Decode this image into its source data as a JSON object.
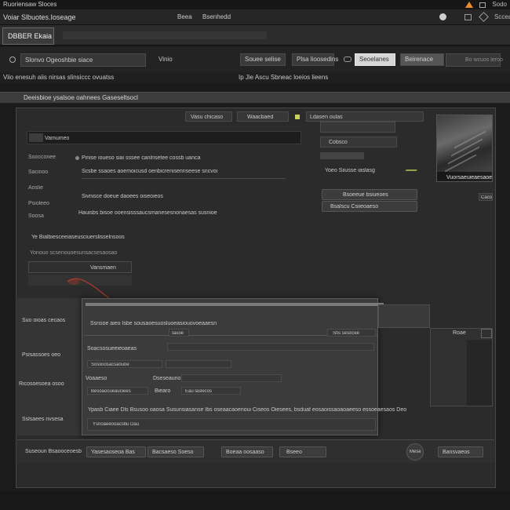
{
  "titlebar": {
    "title": "Ruoriensaw Sloces",
    "right_label": "Sodo"
  },
  "menubar": {
    "title": "Voiar Slbuotes.Ioseage",
    "items": [
      "Beea",
      "Bsenhedd",
      "Scceahs"
    ]
  },
  "tabs": {
    "active": "DBBER Ekaia"
  },
  "toolbar": {
    "location": "Slonvo Ogeoshbie siace",
    "view": "Vinio",
    "sort": "Souee selise",
    "filter": "Plsa lioosedins",
    "btn_light": "Seoelanes",
    "btn_dark": "Beirenace",
    "search_placeholder": "Bo wcuos leroo"
  },
  "address": {
    "path": "Viio enesuh aiis nirsas slinsiccc ovuatss",
    "right": "Ip Jie Ascu Sbneac loeios lieens"
  },
  "section": {
    "title": "Deeisbioe ysalsoe oahnees Gaseseltsocl"
  },
  "filterrow": {
    "a": "Vasu chicaso",
    "b": "Waacbaed",
    "c": "Ldasen oulas"
  },
  "main": {
    "field_label": "Vamumeo",
    "right_field": "Cobsco",
    "rows_left": [
      "Soocconee",
      "Sacinoo",
      "Aoslie",
      "Psioleeo",
      "Soosa"
    ],
    "row1": "Pinise ioueso siai sssee canlrisetee cossb uanca",
    "row2": "Scsbe ssaoes aoemoicusd oenbicrenisenriseese sncvoi",
    "row3": "Sivnisce doeue daoees oiseoieos",
    "row4": "Hauisbs bisoe ooensisssaucsmanesesnonaesas susnioe",
    "row5": "Ye Bialbiesceeiaseusciuerslisselnsoos",
    "note": "Yonouo scsenouoesunsacsesaosao",
    "combo": "Vansmaen",
    "right_note": "Yoeo Siiusse iaslasg",
    "right_btn1": "Bsoeeue bsiueoes",
    "right_btn2": "Bsalscu Csiieoaeso",
    "thumb_caption": "Vuorsaeuieaesaoe",
    "thumb_btn": "Caco"
  },
  "dialog": {
    "heading": "Ssnsoe aieo Isbe sousaoesuosluoeasiouovoeaaesn",
    "sidebar": [
      "Suo oioas cecaos",
      "Psisassoes oeo",
      "Ricosoesoea osoo",
      "Sslsaees nvsesa"
    ],
    "f1_label": "Soacsosueeieoaeas",
    "f1_btn": "Iauoe",
    "f1_right": "Sfis sesocee",
    "f2": "Sosiioosacsaouoe",
    "f3a": "Voaaeso",
    "f3b": "Dseseauno",
    "f4a": "Besoaocueauciees",
    "f4b": "Biearo",
    "f4c": "Eau laslecos",
    "long": "Ypasb Ciaee Dls Bsusoo oaosa Susunsiasanse Ibs oseaacaoenoui Ciseos Oiesees, bsduaf eosaoissaoaoaeeso essoeaesaos Deo",
    "footer_field": "Ysnoaeeooacsbu Dau"
  },
  "rightpane": {
    "title": "Roae"
  },
  "bottombar": {
    "label": "Suseoun Bsaooceoesb",
    "b1": "Yasesaoseoa Bas",
    "b2": "Bacsaeso Soeso",
    "b3": "Boeaa oosaaso",
    "b4": "Bseeo",
    "b5": "Mese",
    "b6": "Bansvaeos"
  },
  "colors": {
    "accent": "#e88c2e",
    "annotation": "#c0392b"
  }
}
